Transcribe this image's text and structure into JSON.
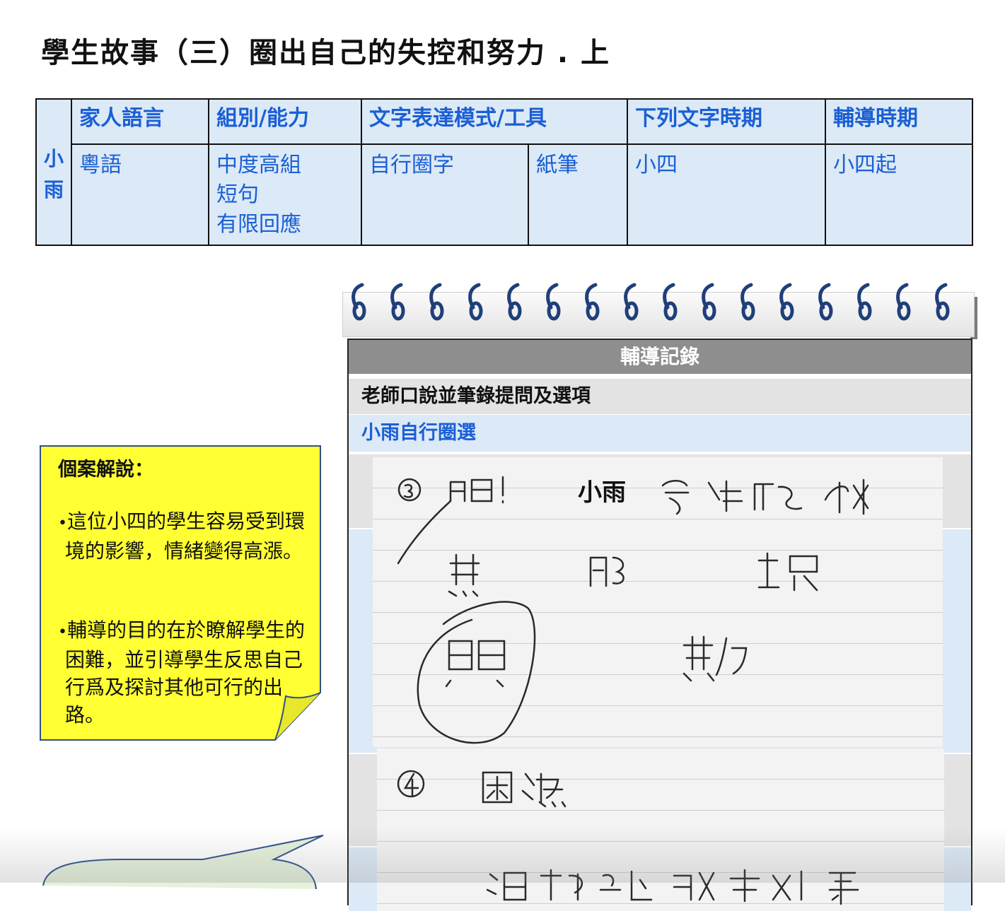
{
  "title": "學生故事（三）圈出自己的失控和努力 . 上",
  "info_table": {
    "student": [
      "小",
      "雨"
    ],
    "headers": [
      "家人語言",
      "組別/能力",
      "文字表達模式/工具",
      "下列文字時期",
      "輔導時期"
    ],
    "family_language": "粵語",
    "group_ability": [
      "中度高組",
      "短句",
      "有限回應"
    ],
    "expression_mode": "自行圈字",
    "tool": "紙筆",
    "writing_period": "小四",
    "counseling_period": "小四起"
  },
  "callout": {
    "title": "個案解說：",
    "items": [
      "這位小四的學生容易受到環境的影響，情緒變得高漲。",
      "輔導的目的在於瞭解學生的困難，並引導學生反思自己行爲及探討其他可行的出路。"
    ],
    "bullet": "•"
  },
  "notebook": {
    "header": "輔導記錄",
    "row_teacher": "老師口說並筆錄提問及選項",
    "row_student": "小雨自行圈選",
    "scan1": {
      "typed_name": "小雨"
    }
  }
}
